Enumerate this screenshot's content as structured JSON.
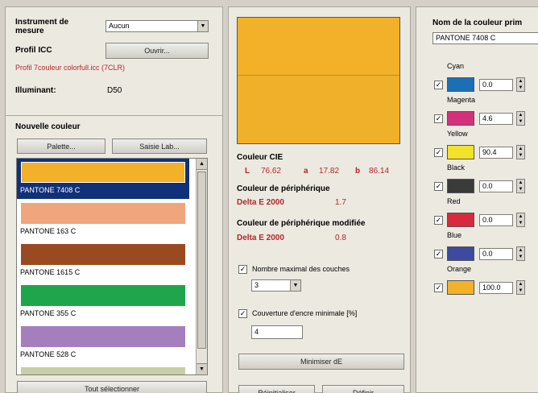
{
  "instrument": {
    "label": "Instrument de mesure",
    "value": "Aucun",
    "icc_label": "Profil ICC",
    "open_button": "Ouvrir...",
    "profile_name": "Profil 7couleur colorfull.icc (7CLR)",
    "illuminant_label": "Illuminant:",
    "illuminant_value": "D50"
  },
  "new_color": {
    "title": "Nouvelle couleur",
    "palette_button": "Palette...",
    "lab_button": "Saisie Lab...",
    "select_all_button": "Tout sélectionner",
    "items": [
      {
        "name": "PANTONE 7408 C",
        "color": "#f3b12a"
      },
      {
        "name": "PANTONE 163 C",
        "color": "#f1a57d"
      },
      {
        "name": "PANTONE 1615 C",
        "color": "#9a4a20"
      },
      {
        "name": "PANTONE 355 C",
        "color": "#1fa64c"
      },
      {
        "name": "PANTONE 528 C",
        "color": "#a57fbd"
      },
      {
        "name": "",
        "color": "#c8cfa7"
      }
    ]
  },
  "preview": {
    "top_color": "#f3b12a",
    "bottom_color": "#f1b02a"
  },
  "cie": {
    "title": "Couleur CIE",
    "L_label": "L",
    "L": "76.62",
    "a_label": "a",
    "a": "17.82",
    "b_label": "b",
    "b": "86.14"
  },
  "device": {
    "title": "Couleur de périphérique",
    "delta_label": "Delta E 2000",
    "delta": "1.7"
  },
  "device_modified": {
    "title": "Couleur de périphérique modifiée",
    "delta_label": "Delta E 2000",
    "delta": "0.8"
  },
  "options": {
    "max_layers_label": "Nombre maximal des couches",
    "max_layers_value": "3",
    "min_coverage_label": "Couverture d'encre minimale [%]",
    "min_coverage_value": "4"
  },
  "actions": {
    "minimize": "Minimiser dE",
    "reset": "Réinitialiser",
    "define": "Définir"
  },
  "channels": {
    "name_label": "Nom de la couleur prim",
    "name_value": "PANTONE 7408 C",
    "items": [
      {
        "label": "Cyan",
        "value": "0.0",
        "color": "#1b6fb5"
      },
      {
        "label": "Magenta",
        "value": "4.6",
        "color": "#d4317c"
      },
      {
        "label": "Yellow",
        "value": "90.4",
        "color": "#f2e22a"
      },
      {
        "label": "Black",
        "value": "0.0",
        "color": "#3a3a38"
      },
      {
        "label": "Red",
        "value": "0.0",
        "color": "#d8293e"
      },
      {
        "label": "Blue",
        "value": "0.0",
        "color": "#3c4aa0"
      },
      {
        "label": "Orange",
        "value": "100.0",
        "color": "#f3b12a"
      }
    ]
  }
}
